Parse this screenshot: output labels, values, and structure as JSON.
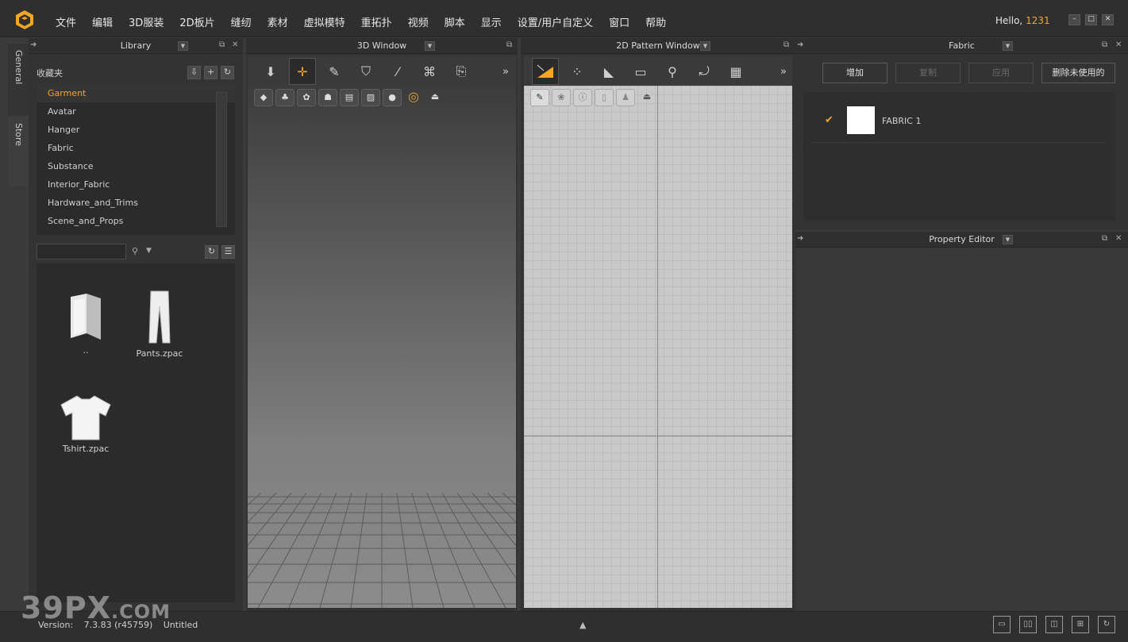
{
  "menubar": {
    "items": [
      "文件",
      "编辑",
      "3D服装",
      "2D板片",
      "缝纫",
      "素材",
      "虚拟模特",
      "重拓扑",
      "视频",
      "脚本",
      "显示",
      "设置/用户自定义",
      "窗口",
      "帮助"
    ],
    "greeting": "Hello,",
    "username": "1231",
    "minimize": "–",
    "maximize": "□",
    "close": "✕"
  },
  "side_tabs": [
    "General",
    "Store"
  ],
  "library": {
    "title": "Library",
    "favorites_label": "收藏夹",
    "favorites": [
      "Garment",
      "Avatar",
      "Hanger",
      "Fabric",
      "Substance",
      "Interior_Fabric",
      "Hardware_and_Trims",
      "Scene_and_Props"
    ],
    "selected_favorite": "Garment",
    "search_placeholder": "",
    "files": [
      {
        "name": "..",
        "icon": "folder-icon"
      },
      {
        "name": "Pants.zpac",
        "icon": "pants-icon"
      },
      {
        "name": "Tshirt.zpac",
        "icon": "tshirt-icon"
      }
    ]
  },
  "window3d": {
    "title": "3D Window",
    "tools": [
      "arrow-down-icon",
      "move-icon",
      "pen-icon",
      "garment-icon",
      "needle-icon",
      "pattern-icon",
      "export-icon"
    ],
    "view_icons": [
      "avatar-icon",
      "garment-icon",
      "texture-icon",
      "person-icon",
      "fabric-icon",
      "surface-icon",
      "head-icon",
      "globe-icon",
      "upload-icon"
    ],
    "active_tool": "move-icon"
  },
  "window2d": {
    "title": "2D Pattern Window",
    "tools": [
      "transform-icon",
      "points-icon",
      "polygon-icon",
      "rectangle-icon",
      "pin-icon",
      "fold-icon",
      "grid-icon"
    ],
    "view_icons": [
      "brush-icon",
      "cloth-icon",
      "info-icon",
      "page-icon",
      "shirt-icon",
      "upload-icon"
    ],
    "active_tool": "transform-icon"
  },
  "fabric": {
    "title": "Fabric",
    "buttons": {
      "add": "增加",
      "copy": "复制",
      "apply": "应用",
      "delete_unused": "删除未使用的"
    },
    "items": [
      {
        "name": "FABRIC 1",
        "color": "#ffffff",
        "checked": true
      }
    ]
  },
  "property_editor": {
    "title": "Property Editor"
  },
  "statusbar": {
    "version_label": "Version:",
    "version": "7.3.83 (r45759)",
    "document": "Untitled",
    "layouts": [
      "single-view-icon",
      "dual-view-icon",
      "triple-view-icon",
      "quad-view-icon",
      "reset-view-icon"
    ]
  },
  "watermark": {
    "main": "39PX",
    "suffix": ".COM"
  },
  "colors": {
    "accent": "#f5a623",
    "panel": "#333333",
    "menubar": "#2f2f2f"
  }
}
